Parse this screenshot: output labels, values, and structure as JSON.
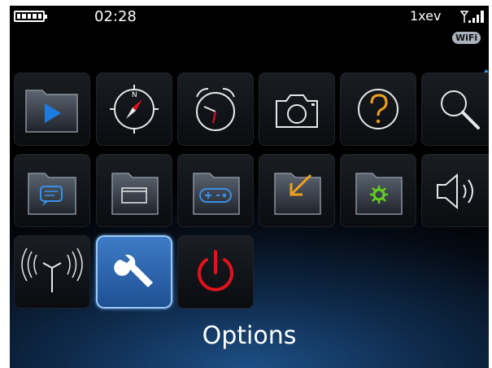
{
  "status_bar": {
    "time": "02:28",
    "network": "1xev",
    "wifi_badge": "WiFi",
    "battery_icon": "battery-full-icon",
    "signal_icon": "signal-bars-icon"
  },
  "home_screen": {
    "selected_label": "Options",
    "scroll_indicator": "scroll-up-arrow-icon",
    "rows": [
      [
        "media-folder-icon",
        "browser-compass-icon",
        "alarm-clock-icon",
        "camera-icon",
        "help-icon",
        "search-icon"
      ],
      [
        "messages-folder-icon",
        "applications-folder-icon",
        "games-folder-icon",
        "downloads-folder-icon",
        "settings-folder-icon",
        "sound-profile-icon"
      ],
      [
        "manage-connections-icon",
        "options-wrench-icon",
        "power-icon"
      ]
    ],
    "selected_index": {
      "row": 2,
      "col": 1
    }
  },
  "colors": {
    "selection": "#3f7cc7",
    "power_red": "#e2131c",
    "folder_green": "#5fd11e",
    "folder_orange": "#f0a020",
    "media_blue": "#1e7be0"
  }
}
